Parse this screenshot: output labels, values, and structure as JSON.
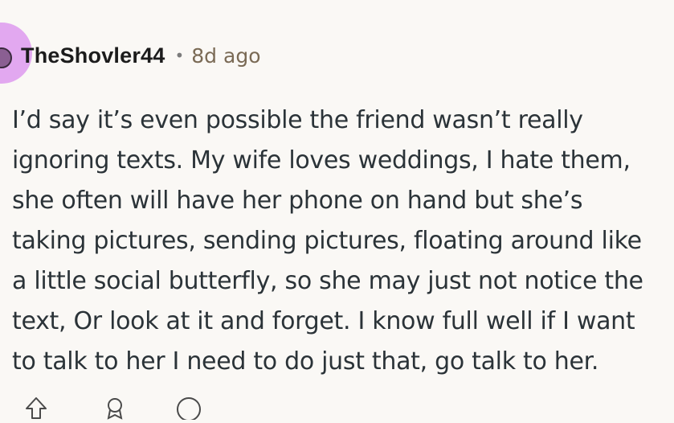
{
  "comment": {
    "author": "TheShovler44",
    "separator": "•",
    "timestamp": "8d ago",
    "body_lines": [
      "I’d say it’s even possible the friend wasn’t really",
      "ignoring texts. My wife loves weddings, I hate them,",
      "she often will have her phone on hand but she’s",
      "taking pictures, sending pictures, floating around like",
      "a little social butterfly, so she may just not notice the",
      "text, Or look at it and forget. I know full well if I want",
      "to talk to her I need to do just that, go talk to her."
    ]
  },
  "icons": {
    "avatar": "user-avatar-icon",
    "upvote": "upvote-arrow-icon",
    "award": "award-icon",
    "reply": "reply-bubble-icon"
  },
  "colors": {
    "background": "#faf8f5",
    "avatar_bg": "#e2a8f0",
    "text": "#2b3338",
    "meta": "#7a6a55"
  }
}
